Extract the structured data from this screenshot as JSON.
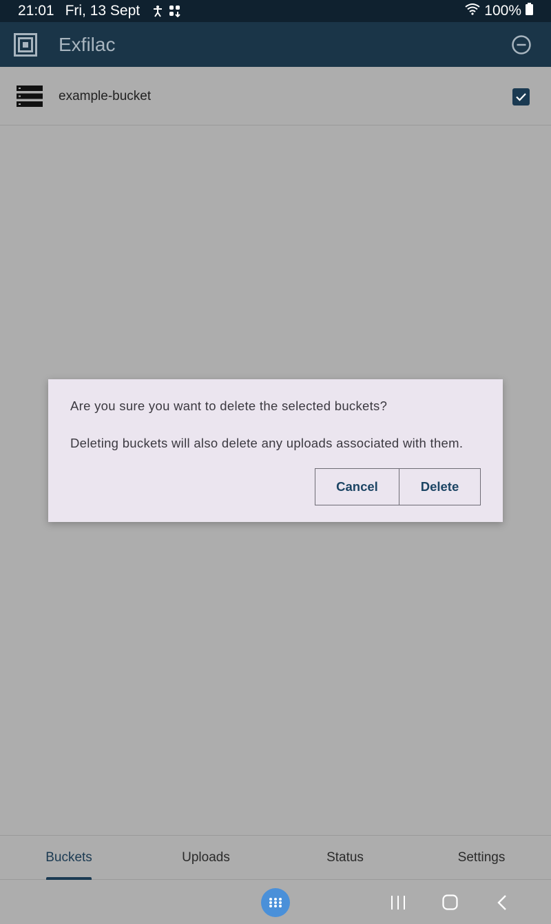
{
  "status_bar": {
    "time": "21:01",
    "date": "Fri, 13 Sept",
    "battery": "100%",
    "icons": [
      "accessibility-icon",
      "multi-window-icon",
      "wifi-icon",
      "battery-icon"
    ]
  },
  "app_bar": {
    "title": "Exfilac",
    "logo_icon": "app-logo-icon",
    "action_icon": "remove-circle-icon",
    "background": "#1a3548"
  },
  "buckets": [
    {
      "name": "example-bucket",
      "checked": true,
      "icon": "bucket-stack-icon"
    }
  ],
  "dialog": {
    "question": "Are you sure you want to delete the selected buckets?",
    "message": "Deleting buckets will also delete any uploads associated with them.",
    "cancel_label": "Cancel",
    "delete_label": "Delete"
  },
  "tabs": [
    {
      "label": "Buckets",
      "active": true
    },
    {
      "label": "Uploads",
      "active": false
    },
    {
      "label": "Status",
      "active": false
    },
    {
      "label": "Settings",
      "active": false
    }
  ],
  "nav_bar": {
    "icons": [
      "apps-grid-icon",
      "recent-apps-icon",
      "home-icon",
      "back-icon"
    ]
  },
  "colors": {
    "accent": "#1b3a52",
    "scrim": "#adadad",
    "dialog_bg": "#ebe5ef",
    "apps_button": "#4a90d9"
  }
}
